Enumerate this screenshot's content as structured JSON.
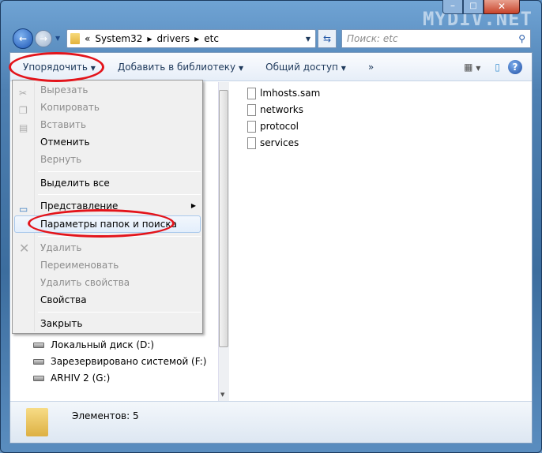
{
  "watermark": "MYDIV.NET",
  "address": {
    "overflow": "«",
    "parts": [
      "System32",
      "drivers",
      "etc"
    ]
  },
  "search": {
    "placeholder": "Поиск: etc"
  },
  "toolbar": {
    "organize": "Упорядочить",
    "add_library": "Добавить в библиотеку",
    "share": "Общий доступ",
    "more": "»"
  },
  "menu": {
    "cut": "Вырезать",
    "copy": "Копировать",
    "paste": "Вставить",
    "undo": "Отменить",
    "redo": "Вернуть",
    "select_all": "Выделить все",
    "layout": "Представление",
    "folder_options": "Параметры папок и поиска",
    "delete": "Удалить",
    "rename": "Переименовать",
    "remove_props": "Удалить свойства",
    "properties": "Свойства",
    "close": "Закрыть"
  },
  "nav": {
    "drives": [
      "Локальный диск (D:)",
      "Зарезервировано системой (F:)",
      "ARHIV 2 (G:)"
    ]
  },
  "files": [
    "lmhosts.sam",
    "networks",
    "protocol",
    "services"
  ],
  "status": {
    "count": "Элементов: 5"
  },
  "colors": {
    "highlight_ellipse": "#e3141b",
    "accent": "#1e395b"
  }
}
